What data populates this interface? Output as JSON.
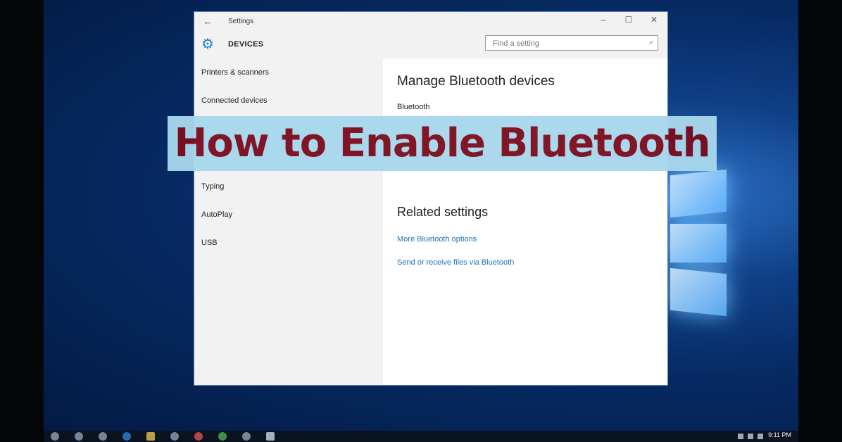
{
  "window": {
    "title": "Settings",
    "back_glyph": "←",
    "minimize_glyph": "–",
    "maximize_glyph": "☐",
    "close_glyph": "✕"
  },
  "header": {
    "section_title": "DEVICES",
    "search_placeholder": "Find a setting",
    "search_icon": "⌕"
  },
  "sidebar": {
    "items": [
      {
        "label": "Printers & scanners"
      },
      {
        "label": "Connected devices"
      },
      {
        "label": "Typing"
      },
      {
        "label": "AutoPlay"
      },
      {
        "label": "USB"
      }
    ]
  },
  "main": {
    "heading": "Manage Bluetooth devices",
    "bluetooth_label": "Bluetooth",
    "related_heading": "Related settings",
    "links": [
      {
        "label": "More Bluetooth options"
      },
      {
        "label": "Send or receive files via Bluetooth"
      }
    ]
  },
  "overlay": {
    "banner_text": "How to Enable Bluetooth"
  },
  "taskbar": {
    "clock": "9:11 PM"
  },
  "colors": {
    "accent": "#1e7ed3",
    "banner_bg": "#a8d7ec",
    "banner_text": "#7b0d1e",
    "link": "#1f6fb8"
  }
}
